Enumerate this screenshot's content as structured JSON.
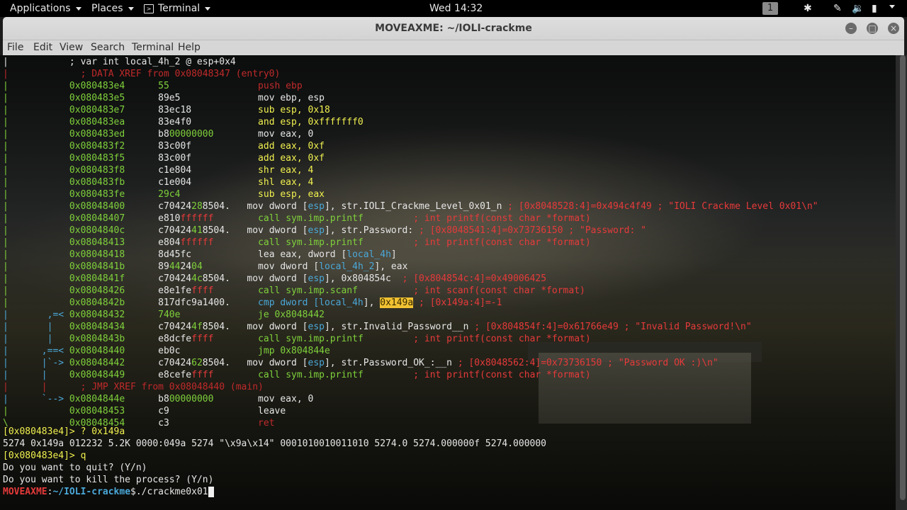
{
  "topbar": {
    "applications": "Applications",
    "places": "Places",
    "terminal": "Terminal",
    "clock": "Wed 14:32",
    "workspace": "1"
  },
  "window": {
    "title": "MOVEAXME: ~/IOLI-crackme"
  },
  "menu": [
    "File",
    "Edit",
    "View",
    "Search",
    "Terminal",
    "Help"
  ],
  "colors": {
    "green": "#7fd13b",
    "red": "#e63a3a",
    "cyan": "#4aa8d8",
    "yellow": "#f1f14f"
  },
  "terminal": {
    "disasm": [
      [
        {
          "t": "|           ; var int local_4h_2 @ esp+0x4",
          "c": "w"
        }
      ],
      [
        {
          "t": "|             ; DATA XREF from 0x08048347 (entry0)",
          "c": "dr"
        }
      ],
      [
        {
          "t": "|           ",
          "c": "gr"
        },
        {
          "t": "0x080483e4      ",
          "c": "gr"
        },
        {
          "t": "55                ",
          "c": "gr"
        },
        {
          "t": "push ebp",
          "c": "dr"
        }
      ],
      [
        {
          "t": "|           ",
          "c": "gr"
        },
        {
          "t": "0x080483e5      ",
          "c": "gr"
        },
        {
          "t": "89e5              ",
          "c": "w"
        },
        {
          "t": "mov ebp, esp",
          "c": "w"
        }
      ],
      [
        {
          "t": "|           ",
          "c": "gr"
        },
        {
          "t": "0x080483e7      ",
          "c": "gr"
        },
        {
          "t": "83ec18            ",
          "c": "w"
        },
        {
          "t": "sub esp, 0x18",
          "c": "yl"
        }
      ],
      [
        {
          "t": "|           ",
          "c": "gr"
        },
        {
          "t": "0x080483ea      ",
          "c": "gr"
        },
        {
          "t": "83e4f0            ",
          "c": "w"
        },
        {
          "t": "and esp, 0xfffffff0",
          "c": "yl"
        }
      ],
      [
        {
          "t": "|           ",
          "c": "gr"
        },
        {
          "t": "0x080483ed      ",
          "c": "gr"
        },
        {
          "t": "b8",
          "c": "w"
        },
        {
          "t": "00000000",
          "c": "gr"
        },
        {
          "t": "        mov eax, 0",
          "c": "w"
        }
      ],
      [
        {
          "t": "|           ",
          "c": "gr"
        },
        {
          "t": "0x080483f2      ",
          "c": "gr"
        },
        {
          "t": "83c00f            ",
          "c": "w"
        },
        {
          "t": "add eax, 0xf",
          "c": "yl"
        }
      ],
      [
        {
          "t": "|           ",
          "c": "gr"
        },
        {
          "t": "0x080483f5      ",
          "c": "gr"
        },
        {
          "t": "83c00f            ",
          "c": "w"
        },
        {
          "t": "add eax, 0xf",
          "c": "yl"
        }
      ],
      [
        {
          "t": "|           ",
          "c": "gr"
        },
        {
          "t": "0x080483f8      ",
          "c": "gr"
        },
        {
          "t": "c1e804            ",
          "c": "w"
        },
        {
          "t": "shr eax, 4",
          "c": "yl"
        }
      ],
      [
        {
          "t": "|           ",
          "c": "gr"
        },
        {
          "t": "0x080483fb      ",
          "c": "gr"
        },
        {
          "t": "c1e004            ",
          "c": "w"
        },
        {
          "t": "shl eax, 4",
          "c": "yl"
        }
      ],
      [
        {
          "t": "|           ",
          "c": "gr"
        },
        {
          "t": "0x080483fe      ",
          "c": "gr"
        },
        {
          "t": "29c4              ",
          "c": "gr"
        },
        {
          "t": "sub esp, eax",
          "c": "yl"
        }
      ],
      [
        {
          "t": "|           ",
          "c": "gr"
        },
        {
          "t": "0x08048400      ",
          "c": "gr"
        },
        {
          "t": "c70424",
          "c": "w"
        },
        {
          "t": "28",
          "c": "gr"
        },
        {
          "t": "8504.   mov dword [",
          "c": "w"
        },
        {
          "t": "esp",
          "c": "cy"
        },
        {
          "t": "], str.IOLI_Crackme_Level_0x01_n ",
          "c": "w"
        },
        {
          "t": "; [0x8048528:4]=0x494c4f49 ; \"IOLI Crackme Level 0x01\\n\"",
          "c": "rd"
        }
      ],
      [
        {
          "t": "|           ",
          "c": "gr"
        },
        {
          "t": "0x08048407      ",
          "c": "gr"
        },
        {
          "t": "e810",
          "c": "w"
        },
        {
          "t": "ffffff",
          "c": "rd"
        },
        {
          "t": "        ",
          "c": "w"
        },
        {
          "t": "call sym.imp.printf",
          "c": "gr"
        },
        {
          "t": "         ; int printf(const char *format)",
          "c": "rd"
        }
      ],
      [
        {
          "t": "|           ",
          "c": "gr"
        },
        {
          "t": "0x0804840c      ",
          "c": "gr"
        },
        {
          "t": "c70424",
          "c": "w"
        },
        {
          "t": "41",
          "c": "gr"
        },
        {
          "t": "8504.   mov dword [",
          "c": "w"
        },
        {
          "t": "esp",
          "c": "cy"
        },
        {
          "t": "], str.Password: ",
          "c": "w"
        },
        {
          "t": "; [0x8048541:4]=0x73736150 ; \"Password: \"",
          "c": "rd"
        }
      ],
      [
        {
          "t": "|           ",
          "c": "gr"
        },
        {
          "t": "0x08048413      ",
          "c": "gr"
        },
        {
          "t": "e804",
          "c": "w"
        },
        {
          "t": "ffffff",
          "c": "rd"
        },
        {
          "t": "        ",
          "c": "w"
        },
        {
          "t": "call sym.imp.printf",
          "c": "gr"
        },
        {
          "t": "         ; int printf(const char *format)",
          "c": "rd"
        }
      ],
      [
        {
          "t": "|           ",
          "c": "gr"
        },
        {
          "t": "0x08048418      ",
          "c": "gr"
        },
        {
          "t": "8d45fc            ",
          "c": "w"
        },
        {
          "t": "lea eax, dword [",
          "c": "w"
        },
        {
          "t": "local_4h",
          "c": "cy"
        },
        {
          "t": "]",
          "c": "w"
        }
      ],
      [
        {
          "t": "|           ",
          "c": "gr"
        },
        {
          "t": "0x0804841b      ",
          "c": "gr"
        },
        {
          "t": "89",
          "c": "w"
        },
        {
          "t": "44",
          "c": "gr"
        },
        {
          "t": "24",
          "c": "w"
        },
        {
          "t": "04",
          "c": "gr"
        },
        {
          "t": "          mov dword [",
          "c": "w"
        },
        {
          "t": "local_4h_2",
          "c": "cy"
        },
        {
          "t": "], eax",
          "c": "w"
        }
      ],
      [
        {
          "t": "|           ",
          "c": "gr"
        },
        {
          "t": "0x0804841f      ",
          "c": "gr"
        },
        {
          "t": "c70424",
          "c": "w"
        },
        {
          "t": "4c",
          "c": "gr"
        },
        {
          "t": "8504.   mov dword [",
          "c": "w"
        },
        {
          "t": "esp",
          "c": "cy"
        },
        {
          "t": "], 0x804854c  ",
          "c": "w"
        },
        {
          "t": "; [0x804854c:4]=0x49006425",
          "c": "rd"
        }
      ],
      [
        {
          "t": "|           ",
          "c": "gr"
        },
        {
          "t": "0x08048426      ",
          "c": "gr"
        },
        {
          "t": "e8e1fe",
          "c": "w"
        },
        {
          "t": "ffff",
          "c": "rd"
        },
        {
          "t": "        ",
          "c": "w"
        },
        {
          "t": "call sym.imp.scanf",
          "c": "gr"
        },
        {
          "t": "          ; int scanf(const char *format)",
          "c": "rd"
        }
      ],
      [
        {
          "t": "|           ",
          "c": "gr"
        },
        {
          "t": "0x0804842b      ",
          "c": "gr"
        },
        {
          "t": "817dfc9a1400.     ",
          "c": "w"
        },
        {
          "t": "cmp dword [",
          "c": "cy"
        },
        {
          "t": "local_4h",
          "c": "cy"
        },
        {
          "t": "], ",
          "c": "w"
        },
        {
          "t": "0x149a",
          "c": "hl"
        },
        {
          "t": " ; [0x149a:4]=-1",
          "c": "rd"
        }
      ],
      [
        {
          "t": "|       ,=< ",
          "c": "cy"
        },
        {
          "t": "0x08048432      ",
          "c": "gr"
        },
        {
          "t": "740e              ",
          "c": "gr"
        },
        {
          "t": "je 0x8048442",
          "c": "gr"
        }
      ],
      [
        {
          "t": "|       |   ",
          "c": "cy"
        },
        {
          "t": "0x08048434      ",
          "c": "gr"
        },
        {
          "t": "c70424",
          "c": "w"
        },
        {
          "t": "4f",
          "c": "gr"
        },
        {
          "t": "8504.   mov dword [",
          "c": "w"
        },
        {
          "t": "esp",
          "c": "cy"
        },
        {
          "t": "], str.Invalid_Password__n ",
          "c": "w"
        },
        {
          "t": "; [0x804854f:4]=0x61766e49 ; \"Invalid Password!\\n\"",
          "c": "rd"
        }
      ],
      [
        {
          "t": "|       |   ",
          "c": "cy"
        },
        {
          "t": "0x0804843b      ",
          "c": "gr"
        },
        {
          "t": "e8dcfe",
          "c": "w"
        },
        {
          "t": "ffff",
          "c": "rd"
        },
        {
          "t": "        ",
          "c": "w"
        },
        {
          "t": "call sym.imp.printf",
          "c": "gr"
        },
        {
          "t": "         ; int printf(const char *format)",
          "c": "rd"
        }
      ],
      [
        {
          "t": "|      ,==< ",
          "c": "cy"
        },
        {
          "t": "0x08048440      ",
          "c": "gr"
        },
        {
          "t": "eb0c              ",
          "c": "w"
        },
        {
          "t": "jmp 0x804844e",
          "c": "gr"
        }
      ],
      [
        {
          "t": "|      |`-> ",
          "c": "cy"
        },
        {
          "t": "0x08048442      ",
          "c": "gr"
        },
        {
          "t": "c70424",
          "c": "w"
        },
        {
          "t": "62",
          "c": "gr"
        },
        {
          "t": "8504.   mov dword [",
          "c": "w"
        },
        {
          "t": "esp",
          "c": "cy"
        },
        {
          "t": "], str.Password_OK_:__n ",
          "c": "w"
        },
        {
          "t": "; [0x8048562:4]=0x73736150 ; \"Password OK :)\\n\"",
          "c": "rd"
        }
      ],
      [
        {
          "t": "|      |    ",
          "c": "cy"
        },
        {
          "t": "0x08048449      ",
          "c": "gr"
        },
        {
          "t": "e8cefe",
          "c": "w"
        },
        {
          "t": "ffff",
          "c": "rd"
        },
        {
          "t": "        ",
          "c": "w"
        },
        {
          "t": "call sym.imp.printf",
          "c": "gr"
        },
        {
          "t": "         ; int printf(const char *format)",
          "c": "rd"
        }
      ],
      [
        {
          "t": "|      |      ; JMP XREF from 0x08048440 (main)",
          "c": "dr"
        }
      ],
      [
        {
          "t": "|      `--> ",
          "c": "cy"
        },
        {
          "t": "0x0804844e      ",
          "c": "gr"
        },
        {
          "t": "b8",
          "c": "w"
        },
        {
          "t": "00000000",
          "c": "gr"
        },
        {
          "t": "        mov eax, 0",
          "c": "w"
        }
      ],
      [
        {
          "t": "|           ",
          "c": "gr"
        },
        {
          "t": "0x08048453      ",
          "c": "gr"
        },
        {
          "t": "c9                ",
          "c": "w"
        },
        {
          "t": "leave",
          "c": "w"
        }
      ],
      [
        {
          "t": "\\           ",
          "c": "gr"
        },
        {
          "t": "0x08048454      ",
          "c": "gr"
        },
        {
          "t": "c3                ",
          "c": "w"
        },
        {
          "t": "ret",
          "c": "dr"
        }
      ]
    ],
    "prompt_cmd1": "[0x080483e4]> ? 0x149a",
    "output1": "5274 0x149a 012232 5.2K 0000:049a 5274 \"\\x9a\\x14\" 0001010010011010 5274.0 5274.000000f 5274.000000",
    "prompt_cmd2": "[0x080483e4]> q",
    "quit_q1": "Do you want to quit? (Y/n)",
    "quit_q2": "Do you want to kill the process? (Y/n)",
    "shell_user": "MOVEAXME",
    "shell_sep": ":",
    "shell_path": "~/IOLI-crackme",
    "shell_cmd": "$./crackme0x01"
  }
}
